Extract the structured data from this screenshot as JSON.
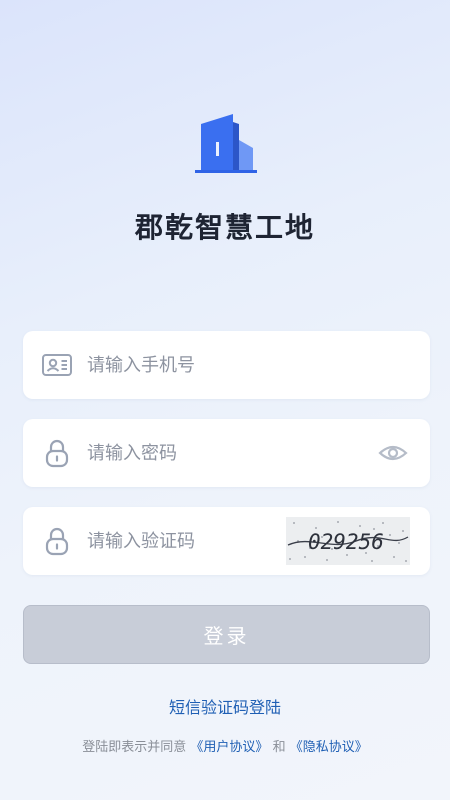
{
  "app": {
    "title": "郡乾智慧工地"
  },
  "form": {
    "phone_placeholder": "请输入手机号",
    "password_placeholder": "请输入密码",
    "code_placeholder": "请输入验证码",
    "captcha_text": "029256"
  },
  "actions": {
    "login_label": "登录",
    "sms_login_label": "短信验证码登陆"
  },
  "agreement": {
    "prefix": "登陆即表示并同意",
    "user_agreement": "《用户协议》",
    "and": "和",
    "privacy_agreement": "《隐私协议》"
  },
  "colors": {
    "brand_blue": "#2f6bef",
    "link_blue": "#1f5fb4",
    "disabled_button": "#c8cdd8"
  },
  "icons": {
    "logo": "building-icon",
    "phone_field": "id-card-icon",
    "password_field": "lock-icon",
    "code_field": "lock-icon",
    "visibility_toggle": "eye-icon"
  }
}
